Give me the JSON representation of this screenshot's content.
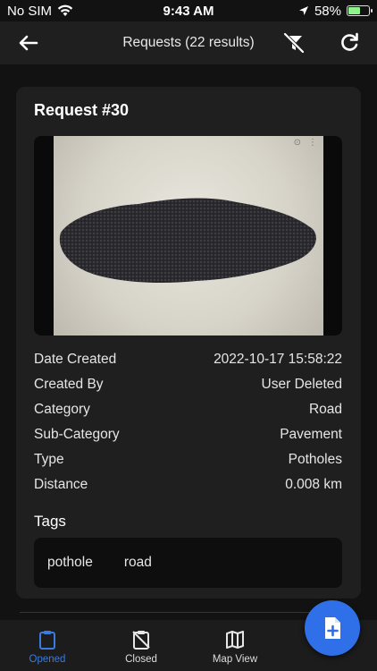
{
  "status_bar": {
    "carrier": "No SIM",
    "time": "9:43 AM",
    "battery": "58%",
    "battery_level": 0.58
  },
  "header": {
    "title": "Requests (22 results)"
  },
  "request": {
    "title": "Request #30",
    "details": [
      {
        "label": "Date Created",
        "value": "2022-10-17 15:58:22"
      },
      {
        "label": "Created By",
        "value": "User Deleted"
      },
      {
        "label": "Category",
        "value": "Road"
      },
      {
        "label": "Sub-Category",
        "value": "Pavement"
      },
      {
        "label": "Type",
        "value": "Potholes"
      },
      {
        "label": "Distance",
        "value": "0.008 km"
      }
    ],
    "tags_heading": "Tags",
    "tags": [
      "pothole",
      "road"
    ]
  },
  "nav": {
    "items": [
      {
        "label": "Opened",
        "icon": "clipboard-icon",
        "active": true
      },
      {
        "label": "Closed",
        "icon": "clipboard-off-icon",
        "active": false
      },
      {
        "label": "Map View",
        "icon": "map-icon",
        "active": false
      }
    ]
  },
  "fab": {
    "icon": "add-file-icon"
  },
  "colors": {
    "accent": "#2f6fe8",
    "background": "#121212",
    "card": "#1f1f1f"
  }
}
